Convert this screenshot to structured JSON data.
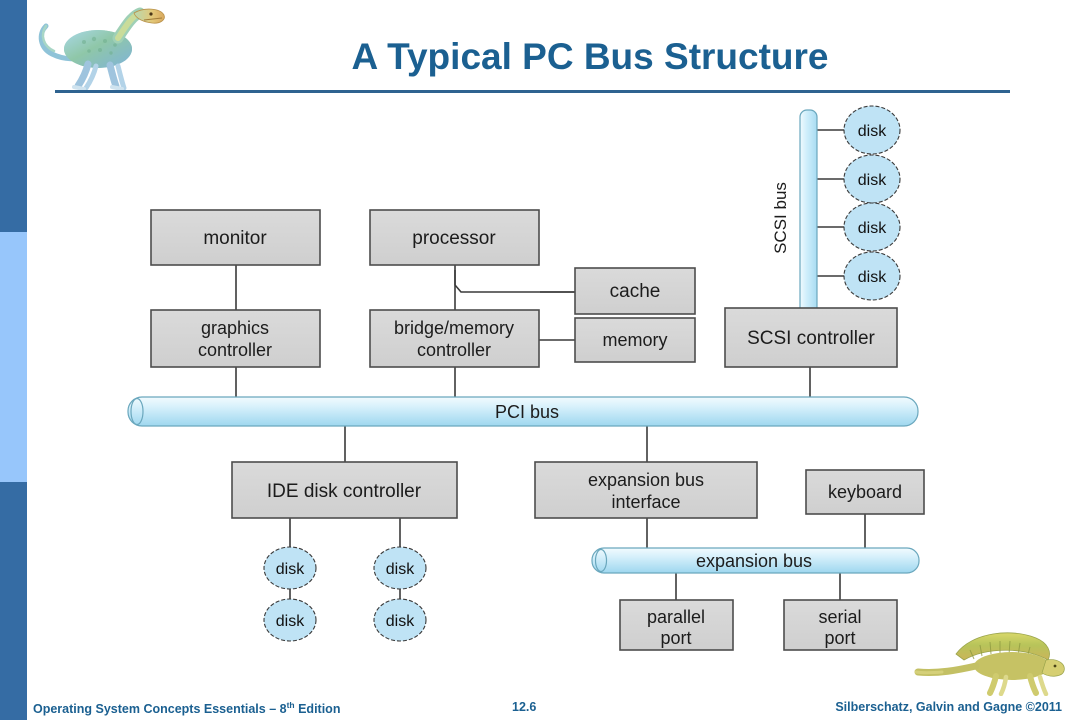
{
  "slide": {
    "title": "A Typical PC Bus Structure",
    "title_color": "#1b6091",
    "rule_color": "#2e6390",
    "background": "#ffffff"
  },
  "sidebar": {
    "segments": [
      {
        "name": "top-dark",
        "color": "#356ca4"
      },
      {
        "name": "middle-light",
        "color": "#97c6fb"
      },
      {
        "name": "bottom-dark",
        "color": "#356ca4"
      }
    ]
  },
  "decorations": {
    "top_logo": "dinosaur-logo",
    "bottom_logo": "dinosaur-logo"
  },
  "diagram": {
    "type": "block-diagram",
    "box_fill": "#d3d3d3",
    "box_stroke": "#4d4d4d",
    "disk_fill": "#bfe3f5",
    "disk_stroke": "#3a3a3a",
    "bus_fill_light": "#eaf7fd",
    "bus_fill_mid": "#a9ddf3",
    "bus_stroke": "#6aa7bd",
    "line_color": "#3a3a3a",
    "boxes": [
      {
        "id": "monitor",
        "label": "monitor"
      },
      {
        "id": "processor",
        "label": "processor"
      },
      {
        "id": "cache",
        "label": "cache"
      },
      {
        "id": "graphics",
        "label": "graphics\ncontroller",
        "line1": "graphics",
        "line2": "controller"
      },
      {
        "id": "bridge",
        "label": "bridge/memory\ncontroller",
        "line1": "bridge/memory",
        "line2": "controller"
      },
      {
        "id": "memory",
        "label": "memory"
      },
      {
        "id": "scsi_controller",
        "label": "SCSI controller"
      },
      {
        "id": "ide_controller",
        "label": "IDE disk controller"
      },
      {
        "id": "expansion_iface",
        "label": "expansion bus\ninterface",
        "line1": "expansion bus",
        "line2": "interface"
      },
      {
        "id": "keyboard",
        "label": "keyboard"
      },
      {
        "id": "parallel_port",
        "label": "parallel\nport",
        "line1": "parallel",
        "line2": "port"
      },
      {
        "id": "serial_port",
        "label": "serial\nport",
        "line1": "serial",
        "line2": "port"
      }
    ],
    "buses": [
      {
        "id": "scsi_bus",
        "label": "SCSI bus",
        "orientation": "vertical"
      },
      {
        "id": "pci_bus",
        "label": "PCI bus",
        "orientation": "horizontal"
      },
      {
        "id": "expansion_bus",
        "label": "expansion bus",
        "orientation": "horizontal"
      }
    ],
    "disks": [
      {
        "id": "scsi_disk_1",
        "label": "disk",
        "attached_to": "scsi_bus"
      },
      {
        "id": "scsi_disk_2",
        "label": "disk",
        "attached_to": "scsi_bus"
      },
      {
        "id": "scsi_disk_3",
        "label": "disk",
        "attached_to": "scsi_bus"
      },
      {
        "id": "scsi_disk_4",
        "label": "disk",
        "attached_to": "scsi_bus"
      },
      {
        "id": "ide_disk_1",
        "label": "disk",
        "attached_to": "ide_controller"
      },
      {
        "id": "ide_disk_2",
        "label": "disk",
        "attached_to": "ide_controller"
      },
      {
        "id": "ide_disk_3",
        "label": "disk",
        "attached_to": "ide_controller"
      },
      {
        "id": "ide_disk_4",
        "label": "disk",
        "attached_to": "ide_controller"
      }
    ]
  },
  "footer": {
    "left_text": "Operating System Concepts Essentials ",
    "left_dash": "– 8",
    "left_sup": "th",
    "left_tail": " Edition",
    "page_number": "12.6",
    "right_text": "Silberschatz, Galvin and Gagne ©2011"
  }
}
